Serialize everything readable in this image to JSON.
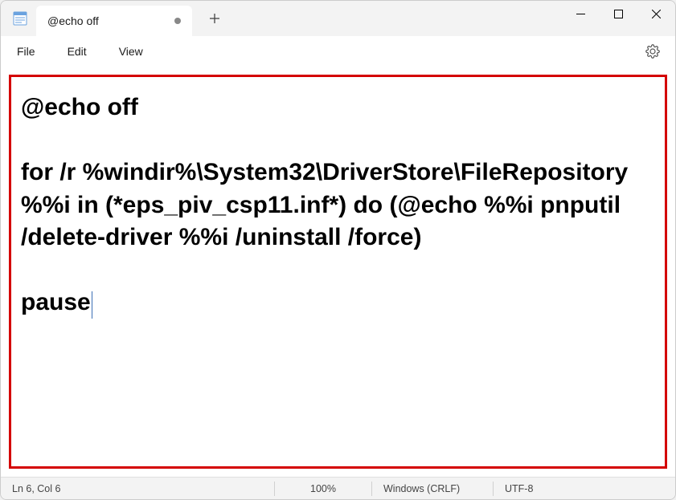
{
  "titlebar": {
    "tab_title": "@echo off"
  },
  "menu": {
    "file": "File",
    "edit": "Edit",
    "view": "View"
  },
  "editor": {
    "content": "@echo off\n\nfor /r %windir%\\System32\\DriverStore\\FileRepository %%i in (*eps_piv_csp11.inf*) do (@echo %%i pnputil /delete-driver %%i /uninstall /force)\n\npause"
  },
  "status": {
    "position": "Ln 6, Col 6",
    "zoom": "100%",
    "line_ending": "Windows (CRLF)",
    "encoding": "UTF-8"
  }
}
